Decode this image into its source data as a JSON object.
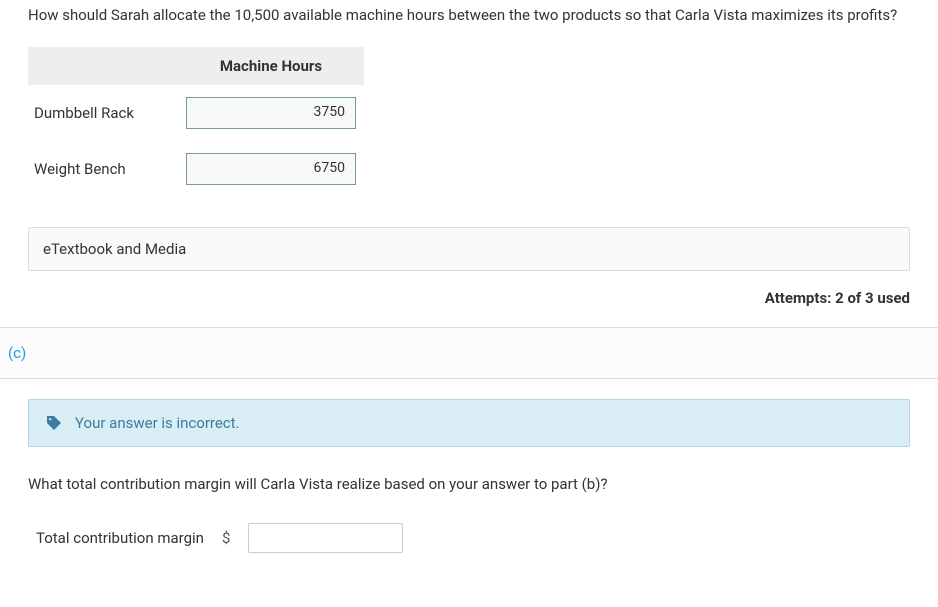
{
  "question_b": "How should Sarah allocate the 10,500 available machine hours between the two products so that Carla Vista maximizes its profits?",
  "table": {
    "header_blank": "",
    "header_hours": "Machine Hours",
    "rows": [
      {
        "label": "Dumbbell Rack",
        "value": "3750"
      },
      {
        "label": "Weight Bench",
        "value": "6750"
      }
    ]
  },
  "etextbook_label": "eTextbook and Media",
  "attempts_text": "Attempts: 2 of 3 used",
  "section_c_label": "(c)",
  "alert_message": "Your answer is incorrect.",
  "question_c": "What total contribution margin will Carla Vista realize based on your answer to part (b)?",
  "input_c": {
    "label": "Total contribution margin",
    "currency": "$",
    "value": ""
  }
}
